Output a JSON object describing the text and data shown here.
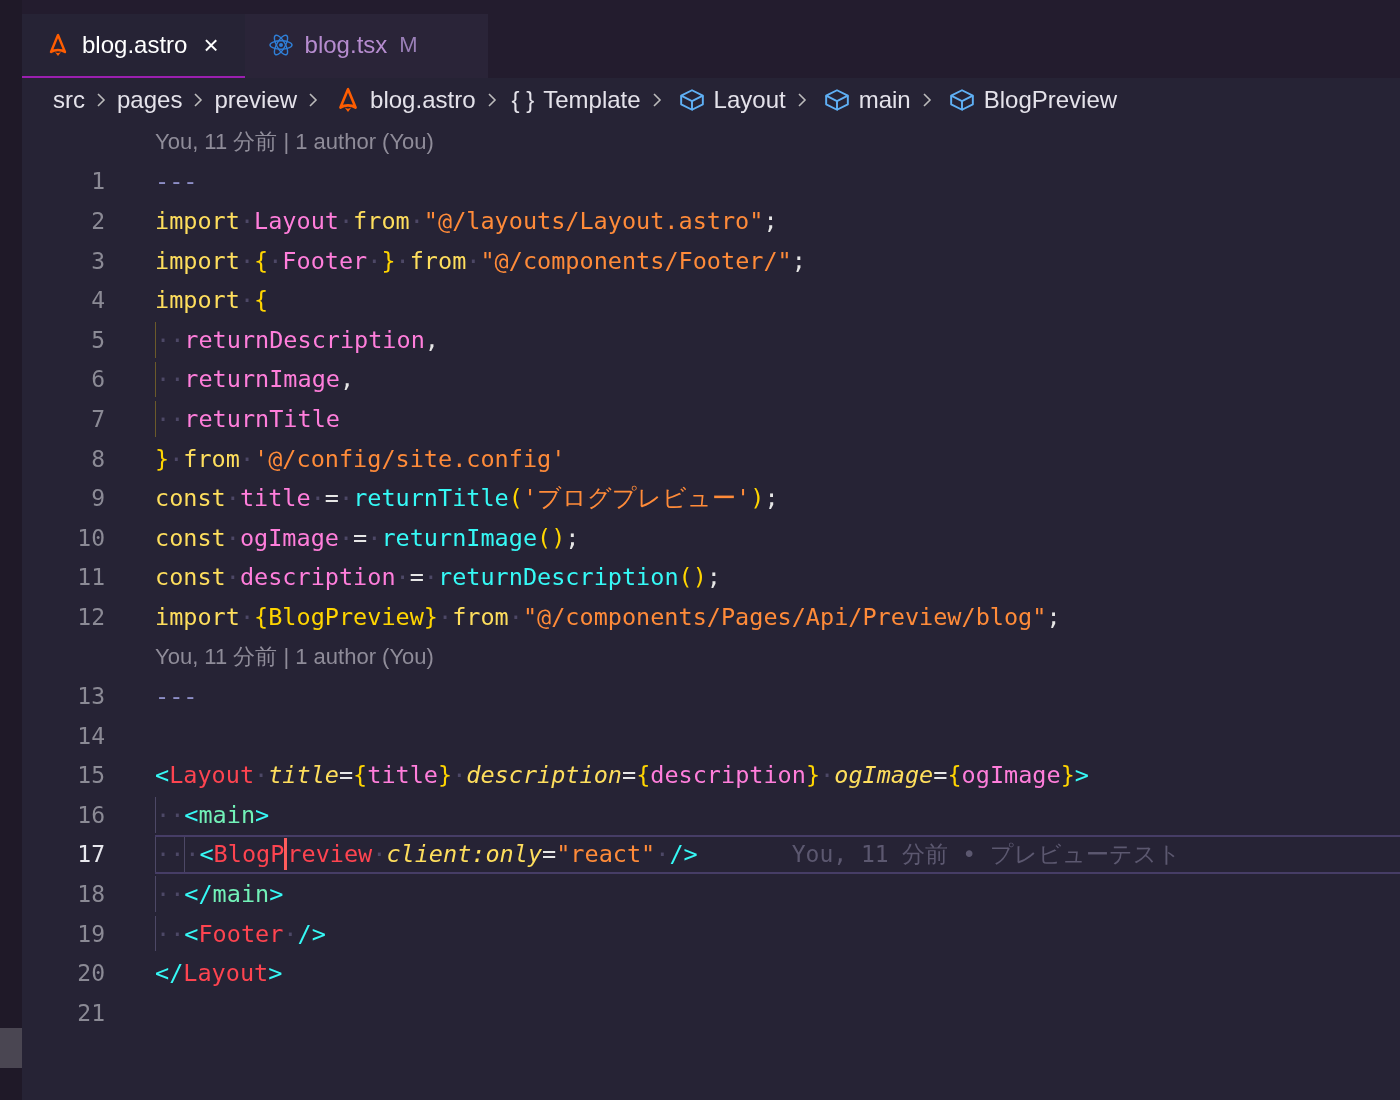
{
  "tabs": [
    {
      "label": "blog.astro",
      "kind": "astro",
      "selected": true,
      "close": "×"
    },
    {
      "label": "blog.tsx",
      "kind": "react",
      "selected": false,
      "badge": "M"
    }
  ],
  "breadcrumbs": [
    {
      "label": "src",
      "kind": "folder"
    },
    {
      "label": "pages",
      "kind": "folder"
    },
    {
      "label": "preview",
      "kind": "folder"
    },
    {
      "label": "blog.astro",
      "kind": "astro"
    },
    {
      "label": "Template",
      "kind": "braces",
      "icon": "{ }"
    },
    {
      "label": "Layout",
      "kind": "component"
    },
    {
      "label": "main",
      "kind": "component"
    },
    {
      "label": "BlogPreview",
      "kind": "component"
    }
  ],
  "lines": [
    {
      "kind": "lens",
      "text": "You, 11 分前 | 1 author (You)"
    },
    {
      "kind": "code",
      "number": "1",
      "current": false,
      "tokens": [
        {
          "kind": "dash",
          "text": "---"
        }
      ]
    },
    {
      "kind": "code",
      "number": "2",
      "current": false,
      "tokens": [
        {
          "kind": "kw",
          "text": "import"
        },
        {
          "kind": "ws",
          "text": "·"
        },
        {
          "kind": "id",
          "text": "Layout"
        },
        {
          "kind": "ws",
          "text": "·"
        },
        {
          "kind": "kw",
          "text": "from"
        },
        {
          "kind": "ws",
          "text": "·"
        },
        {
          "kind": "str",
          "text": "\"@/layouts/Layout.astro\""
        },
        {
          "kind": "p",
          "text": ";"
        }
      ]
    },
    {
      "kind": "code",
      "number": "3",
      "current": false,
      "tokens": [
        {
          "kind": "kw",
          "text": "import"
        },
        {
          "kind": "ws",
          "text": "·"
        },
        {
          "kind": "br",
          "text": "{"
        },
        {
          "kind": "ws",
          "text": "·"
        },
        {
          "kind": "id",
          "text": "Footer"
        },
        {
          "kind": "ws",
          "text": "·"
        },
        {
          "kind": "br",
          "text": "}"
        },
        {
          "kind": "ws",
          "text": "·"
        },
        {
          "kind": "kw",
          "text": "from"
        },
        {
          "kind": "ws",
          "text": "·"
        },
        {
          "kind": "str",
          "text": "\"@/components/Footer/\""
        },
        {
          "kind": "p",
          "text": ";"
        }
      ]
    },
    {
      "kind": "code",
      "number": "4",
      "current": false,
      "tokens": [
        {
          "kind": "kw",
          "text": "import"
        },
        {
          "kind": "ws",
          "text": "·"
        },
        {
          "kind": "br",
          "text": "{"
        }
      ]
    },
    {
      "kind": "code",
      "number": "5",
      "current": false,
      "tokens": [
        {
          "kind": "guide_y",
          "text": "··"
        },
        {
          "kind": "id",
          "text": "returnDescription"
        },
        {
          "kind": "p",
          "text": ","
        }
      ]
    },
    {
      "kind": "code",
      "number": "6",
      "current": false,
      "tokens": [
        {
          "kind": "guide_y",
          "text": "··"
        },
        {
          "kind": "id",
          "text": "returnImage"
        },
        {
          "kind": "p",
          "text": ","
        }
      ]
    },
    {
      "kind": "code",
      "number": "7",
      "current": false,
      "tokens": [
        {
          "kind": "guide_y",
          "text": "··"
        },
        {
          "kind": "id",
          "text": "returnTitle"
        }
      ]
    },
    {
      "kind": "code",
      "number": "8",
      "current": false,
      "tokens": [
        {
          "kind": "br",
          "text": "}"
        },
        {
          "kind": "ws",
          "text": "·"
        },
        {
          "kind": "kw",
          "text": "from"
        },
        {
          "kind": "ws",
          "text": "·"
        },
        {
          "kind": "str",
          "text": "'@/config/site.config'"
        }
      ]
    },
    {
      "kind": "code",
      "number": "9",
      "current": false,
      "tokens": [
        {
          "kind": "kw",
          "text": "const"
        },
        {
          "kind": "ws",
          "text": "·"
        },
        {
          "kind": "id",
          "text": "title"
        },
        {
          "kind": "ws",
          "text": "·"
        },
        {
          "kind": "p",
          "text": "="
        },
        {
          "kind": "ws",
          "text": "·"
        },
        {
          "kind": "fn",
          "text": "returnTitle"
        },
        {
          "kind": "br",
          "text": "("
        },
        {
          "kind": "str",
          "text": "'ブログプレビュー'"
        },
        {
          "kind": "br",
          "text": ")"
        },
        {
          "kind": "p",
          "text": ";"
        }
      ]
    },
    {
      "kind": "code",
      "number": "10",
      "current": false,
      "tokens": [
        {
          "kind": "kw",
          "text": "const"
        },
        {
          "kind": "ws",
          "text": "·"
        },
        {
          "kind": "id",
          "text": "ogImage"
        },
        {
          "kind": "ws",
          "text": "·"
        },
        {
          "kind": "p",
          "text": "="
        },
        {
          "kind": "ws",
          "text": "·"
        },
        {
          "kind": "fn",
          "text": "returnImage"
        },
        {
          "kind": "br",
          "text": "()"
        },
        {
          "kind": "p",
          "text": ";"
        }
      ]
    },
    {
      "kind": "code",
      "number": "11",
      "current": false,
      "tokens": [
        {
          "kind": "kw",
          "text": "const"
        },
        {
          "kind": "ws",
          "text": "·"
        },
        {
          "kind": "id",
          "text": "description"
        },
        {
          "kind": "ws",
          "text": "·"
        },
        {
          "kind": "p",
          "text": "="
        },
        {
          "kind": "ws",
          "text": "·"
        },
        {
          "kind": "fn",
          "text": "returnDescription"
        },
        {
          "kind": "br",
          "text": "()"
        },
        {
          "kind": "p",
          "text": ";"
        }
      ]
    },
    {
      "kind": "code",
      "number": "12",
      "current": false,
      "tokens": [
        {
          "kind": "kw",
          "text": "import"
        },
        {
          "kind": "ws",
          "text": "·"
        },
        {
          "kind": "br",
          "text": "{BlogPreview}"
        },
        {
          "kind": "ws",
          "text": "·"
        },
        {
          "kind": "kw",
          "text": "from"
        },
        {
          "kind": "ws",
          "text": "·"
        },
        {
          "kind": "str",
          "text": "\"@/components/Pages/Api/Preview/blog\""
        },
        {
          "kind": "p",
          "text": ";"
        }
      ]
    },
    {
      "kind": "lens",
      "text": "You, 11 分前 | 1 author (You)"
    },
    {
      "kind": "code",
      "number": "13",
      "current": false,
      "tokens": [
        {
          "kind": "dash",
          "text": "---"
        }
      ]
    },
    {
      "kind": "code",
      "number": "14",
      "current": false
    },
    {
      "kind": "code",
      "number": "15",
      "current": false,
      "tokens": [
        {
          "kind": "tagp",
          "text": "<"
        },
        {
          "kind": "tag",
          "text": "Layout"
        },
        {
          "kind": "ws",
          "text": "·"
        },
        {
          "kind": "attr",
          "text": "title"
        },
        {
          "kind": "p",
          "text": "="
        },
        {
          "kind": "br",
          "text": "{"
        },
        {
          "kind": "id",
          "text": "title"
        },
        {
          "kind": "br",
          "text": "}"
        },
        {
          "kind": "ws",
          "text": "·"
        },
        {
          "kind": "attr",
          "text": "description"
        },
        {
          "kind": "p",
          "text": "="
        },
        {
          "kind": "br",
          "text": "{"
        },
        {
          "kind": "id",
          "text": "description"
        },
        {
          "kind": "br",
          "text": "}"
        },
        {
          "kind": "ws",
          "text": "·"
        },
        {
          "kind": "attr",
          "text": "ogImage"
        },
        {
          "kind": "p",
          "text": "="
        },
        {
          "kind": "br",
          "text": "{"
        },
        {
          "kind": "id",
          "text": "ogImage"
        },
        {
          "kind": "br",
          "text": "}"
        },
        {
          "kind": "tagp",
          "text": ">"
        }
      ]
    },
    {
      "kind": "code",
      "number": "16",
      "current": false,
      "tokens": [
        {
          "kind": "guide",
          "text": "··"
        },
        {
          "kind": "tagp",
          "text": "<"
        },
        {
          "kind": "tag2",
          "text": "main"
        },
        {
          "kind": "tagp",
          "text": ">"
        }
      ]
    },
    {
      "kind": "code",
      "number": "17",
      "current": true,
      "blame": "You, 11 分前 • プレビューテスト",
      "tokens": [
        {
          "kind": "guide",
          "text": "··"
        },
        {
          "kind": "guide",
          "text": "·"
        },
        {
          "kind": "tagp",
          "text": "<"
        },
        {
          "kind": "tag",
          "text": "BlogP"
        },
        {
          "kind": "cursor"
        },
        {
          "kind": "tag",
          "text": "review"
        },
        {
          "kind": "ws",
          "text": "·"
        },
        {
          "kind": "attr",
          "text": "client:only"
        },
        {
          "kind": "p",
          "text": "="
        },
        {
          "kind": "str",
          "text": "\"react\""
        },
        {
          "kind": "ws",
          "text": "·"
        },
        {
          "kind": "tagp",
          "text": "/>"
        }
      ]
    },
    {
      "kind": "code",
      "number": "18",
      "current": false,
      "tokens": [
        {
          "kind": "guide",
          "text": "··"
        },
        {
          "kind": "tagp",
          "text": "</"
        },
        {
          "kind": "tag2",
          "text": "main"
        },
        {
          "kind": "tagp",
          "text": ">"
        }
      ]
    },
    {
      "kind": "code",
      "number": "19",
      "current": false,
      "tokens": [
        {
          "kind": "guide",
          "text": "··"
        },
        {
          "kind": "tagp",
          "text": "<"
        },
        {
          "kind": "tag",
          "text": "Footer"
        },
        {
          "kind": "ws",
          "text": "·"
        },
        {
          "kind": "tagp",
          "text": "/>"
        }
      ]
    },
    {
      "kind": "code",
      "number": "20",
      "current": false,
      "tokens": [
        {
          "kind": "tagp",
          "text": "</"
        },
        {
          "kind": "tag",
          "text": "Layout"
        },
        {
          "kind": "tagp",
          "text": ">"
        }
      ]
    },
    {
      "kind": "code",
      "number": "21",
      "current": false
    }
  ]
}
